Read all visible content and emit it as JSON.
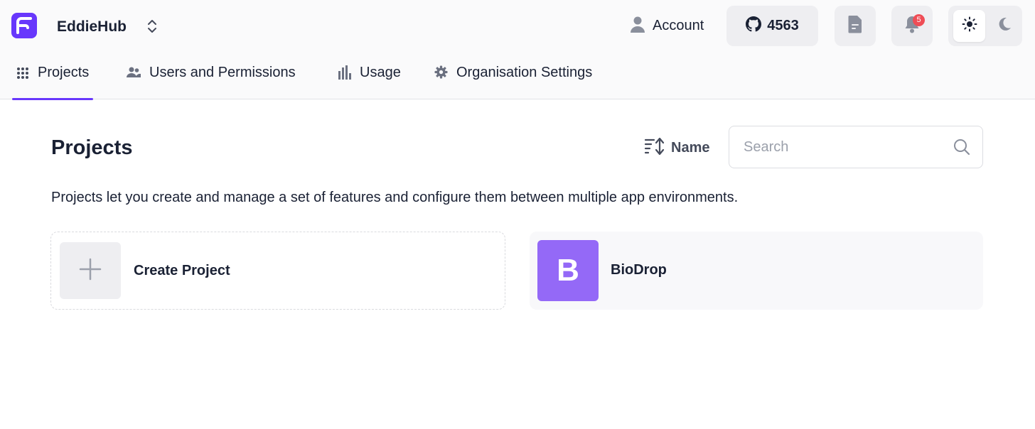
{
  "header": {
    "org_name": "EddieHub",
    "account_label": "Account",
    "github_stars": "4563",
    "notification_count": "5",
    "accent_color": "#6837fc"
  },
  "tabs": [
    {
      "label": "Projects",
      "icon": "grid-icon",
      "active": true
    },
    {
      "label": "Users and Permissions",
      "icon": "users-icon",
      "active": false
    },
    {
      "label": "Usage",
      "icon": "bar-chart-icon",
      "active": false
    },
    {
      "label": "Organisation Settings",
      "icon": "gear-icon",
      "active": false
    }
  ],
  "main": {
    "title": "Projects",
    "sort_label": "Name",
    "search_placeholder": "Search",
    "search_value": "",
    "description": "Projects let you create and manage a set of features and configure them between multiple app environments."
  },
  "cards": {
    "create_label": "Create Project",
    "projects": [
      {
        "name": "BioDrop",
        "initial": "B",
        "color": "#9469f7"
      }
    ]
  }
}
